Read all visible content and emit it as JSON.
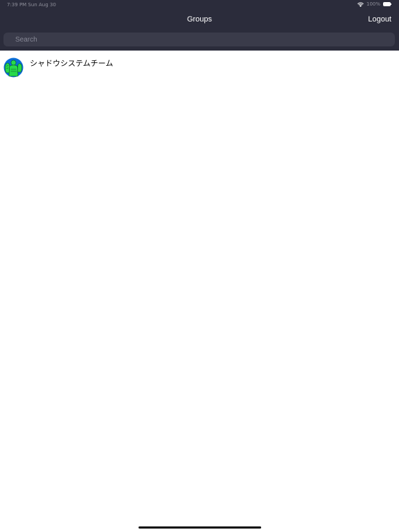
{
  "status_bar": {
    "time_date": "7:39 PM  Sun Aug 30",
    "battery": "100%"
  },
  "header": {
    "title": "Groups",
    "logout_label": "Logout"
  },
  "search": {
    "placeholder": "Search",
    "value": ""
  },
  "groups": [
    {
      "name": "シャドウシステムチーム",
      "avatar_icon": "group-avatar-icon"
    }
  ],
  "colors": {
    "header_bg": "#2b2c3b",
    "search_bg": "#3a3b4a",
    "avatar_green": "#28d94b",
    "avatar_blue": "#0b6ed7"
  }
}
